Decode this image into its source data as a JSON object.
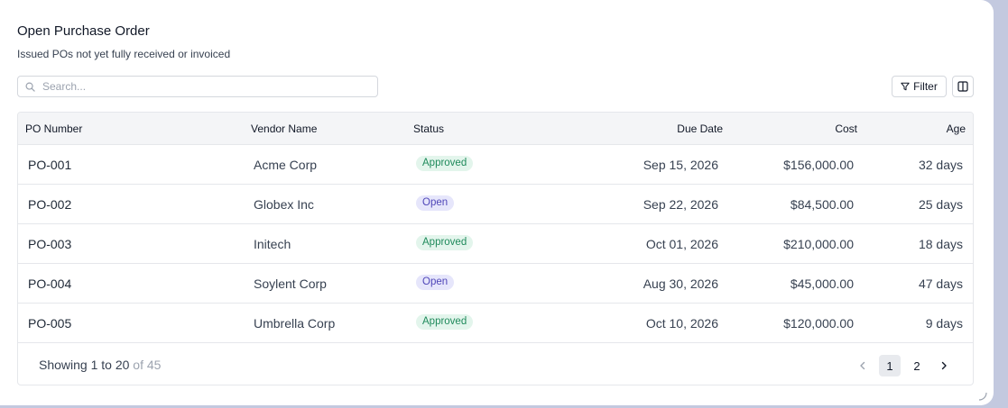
{
  "header": {
    "title": "Open Purchase Order",
    "subtitle": "Issued POs not yet fully received or invoiced"
  },
  "toolbar": {
    "search_placeholder": "Search...",
    "search_icon": "search-icon",
    "filter_label": "Filter",
    "filter_icon": "filter-icon",
    "columns_icon": "columns-icon"
  },
  "table": {
    "columns": [
      "PO Number",
      "Vendor Name",
      "Status",
      "Due Date",
      "Cost",
      "Age"
    ],
    "rows": [
      {
        "po": "PO-001",
        "vendor": "Acme Corp",
        "status": "Approved",
        "due": "Sep 15, 2026",
        "cost": "$156,000.00",
        "age": "32 days"
      },
      {
        "po": "PO-002",
        "vendor": "Globex Inc",
        "status": "Open",
        "due": "Sep 22, 2026",
        "cost": "$84,500.00",
        "age": "25 days"
      },
      {
        "po": "PO-003",
        "vendor": "Initech",
        "status": "Approved",
        "due": "Oct 01, 2026",
        "cost": "$210,000.00",
        "age": "18 days"
      },
      {
        "po": "PO-004",
        "vendor": "Soylent Corp",
        "status": "Open",
        "due": "Aug 30, 2026",
        "cost": "$45,000.00",
        "age": "47 days"
      },
      {
        "po": "PO-005",
        "vendor": "Umbrella Corp",
        "status": "Approved",
        "due": "Oct 10, 2026",
        "cost": "$120,000.00",
        "age": "9 days"
      }
    ]
  },
  "footer": {
    "showing_text": "Showing 1 to 20",
    "total_text": "of 45",
    "pages": [
      "1",
      "2"
    ],
    "current_page": "1"
  },
  "colors": {
    "background": "#c3c9df",
    "approved_bg": "#e3f5ec",
    "approved_text": "#1f8a5b",
    "open_bg": "#e6e6fb",
    "open_text": "#4f46b8"
  }
}
